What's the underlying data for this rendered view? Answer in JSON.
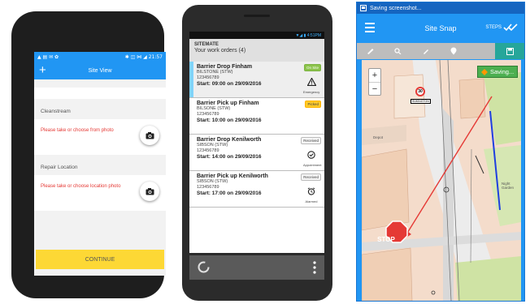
{
  "phone1": {
    "status_left": "▲ ▤ ✉ ✿",
    "status_right": "✱ ◫ ⋈ ◢ 21:57",
    "appbar_title": "Site View",
    "plus_label": "+",
    "section1_label": "Cleanstream",
    "section1_prompt": "Please take or choose from photo",
    "section2_label": "Repair Location",
    "section2_prompt": "Please take or choose location photo",
    "continue_label": "CONTINUE",
    "camera_icon": "camera-icon"
  },
  "phone2": {
    "status_time": "▼◢ ▮ 4:51PM",
    "header_title": "SITEMATE",
    "header_subtitle": "Your work orders (4)",
    "work_orders": [
      {
        "title": "Barrier Drop Finham",
        "location": "BILSTONE (STW)",
        "ref": "123456789",
        "start": "Start: 09:00 on 29/09/2016",
        "badge": "On Site",
        "badge_color": "#8bc34a",
        "type_icon": "warning-icon",
        "type_label": "Emergency",
        "bar_color": "#81d4fa",
        "selected": true
      },
      {
        "title": "Barrier Pick up Finham",
        "location": "BILSONE (STW)",
        "ref": "123456789",
        "start": "Start: 10:00 on 29/09/2016",
        "badge": "Picked",
        "badge_color": "#ffca28",
        "type_icon": "",
        "type_label": "",
        "bar_color": "",
        "selected": false
      },
      {
        "title": "Barrier Drop Kenilworth",
        "location": "SIBSON (STW)",
        "ref": "123456789",
        "start": "Start: 14:00 on 29/09/2016",
        "badge": "Received",
        "badge_color": "#f5f5f5",
        "type_icon": "check-circle-icon",
        "type_label": "Appointment",
        "bar_color": "",
        "selected": false
      },
      {
        "title": "Barrier Pick up Kenilworth",
        "location": "SIBSON (STW)",
        "ref": "123456789",
        "start": "Start: 17:00 on 29/09/2016",
        "badge": "Received",
        "badge_color": "#f5f5f5",
        "type_icon": "alarm-clock-icon",
        "type_label": "Alarmed",
        "bar_color": "",
        "selected": false
      }
    ]
  },
  "phone3": {
    "status_text": "Saving screenshot...",
    "title": "Site Snap",
    "steps_label": "STEPS",
    "saving_label": "Saving...",
    "zoom_in": "+",
    "zoom_out": "−",
    "speed_sign": "30",
    "stop_sign": "STOP",
    "map_labels": {
      "depot": "Depot",
      "kurin": "SUKINGTON",
      "night": "Night Garden"
    }
  }
}
